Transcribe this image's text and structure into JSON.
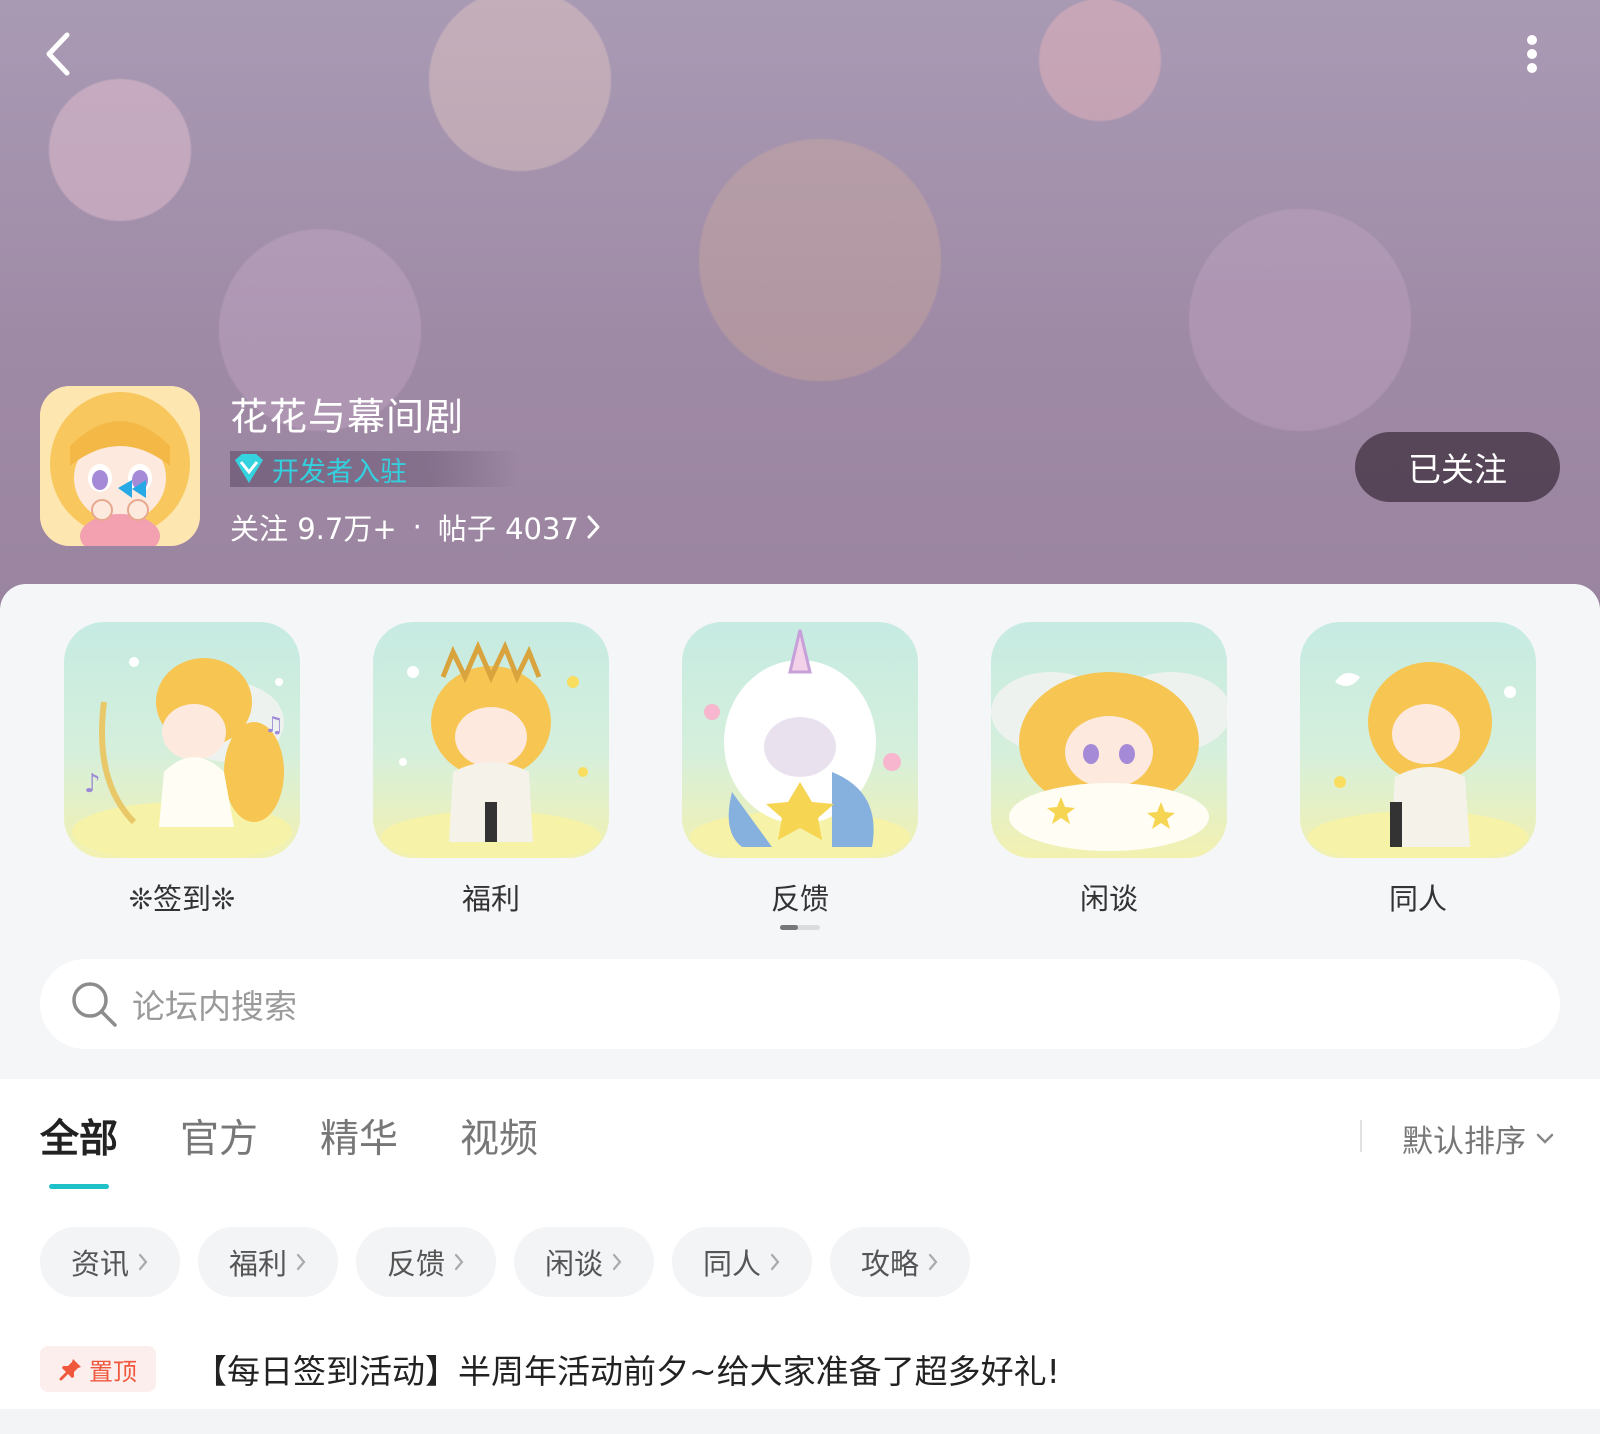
{
  "header": {
    "back_icon": "chevron-left-icon",
    "more_icon": "more-vertical-icon",
    "app_title": "花花与幕间剧",
    "developer_badge": "开发者入驻",
    "followers": "关注 9.7万+",
    "separator": "·",
    "posts": "帖子 4037",
    "follow_button": "已关注"
  },
  "quick_categories": [
    {
      "label": "❊签到❊"
    },
    {
      "label": "福利"
    },
    {
      "label": "反馈"
    },
    {
      "label": "闲谈"
    },
    {
      "label": "同人"
    }
  ],
  "search": {
    "placeholder": "论坛内搜索"
  },
  "tabs": [
    {
      "label": "全部",
      "active": true
    },
    {
      "label": "官方",
      "active": false
    },
    {
      "label": "精华",
      "active": false
    },
    {
      "label": "视频",
      "active": false
    }
  ],
  "sort": {
    "label": "默认排序"
  },
  "chips": [
    {
      "label": "资讯"
    },
    {
      "label": "福利"
    },
    {
      "label": "反馈"
    },
    {
      "label": "闲谈"
    },
    {
      "label": "同人"
    },
    {
      "label": "攻略"
    }
  ],
  "pinned_post": {
    "badge": "置顶",
    "title": "【每日签到活动】半周年活动前夕~给大家准备了超多好礼!"
  },
  "colors": {
    "accent": "#1fc0c8",
    "badge_text": "#33d0de",
    "pin_red": "#f0583e"
  }
}
